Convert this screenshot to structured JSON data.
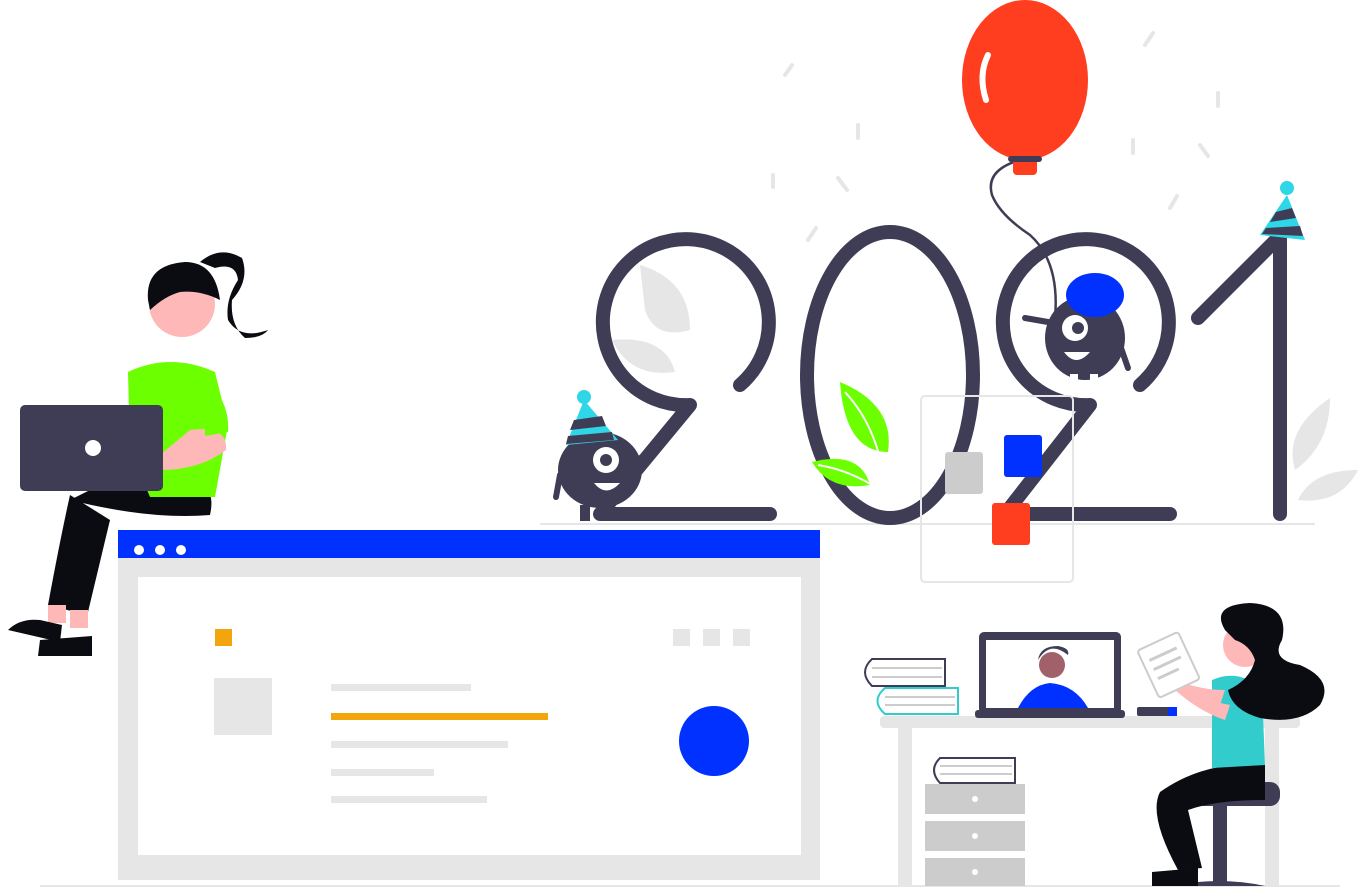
{
  "illustration": {
    "year_digits": [
      "2",
      "0",
      "2",
      "1"
    ],
    "browser_window": {
      "title_dots": 3,
      "toolbar_squares": 3,
      "text_lines": 5
    },
    "colors": {
      "dark": "#3f3d56",
      "blue": "#0031ff",
      "green": "#6cff00",
      "orange": "#f2a50c",
      "red": "#ff3d1f",
      "cyan": "#2fd6e8",
      "teal": "#33cccc",
      "skin": "#ffb8b8",
      "light_gray": "#e6e6e6",
      "hair": "#0b0b12"
    }
  }
}
